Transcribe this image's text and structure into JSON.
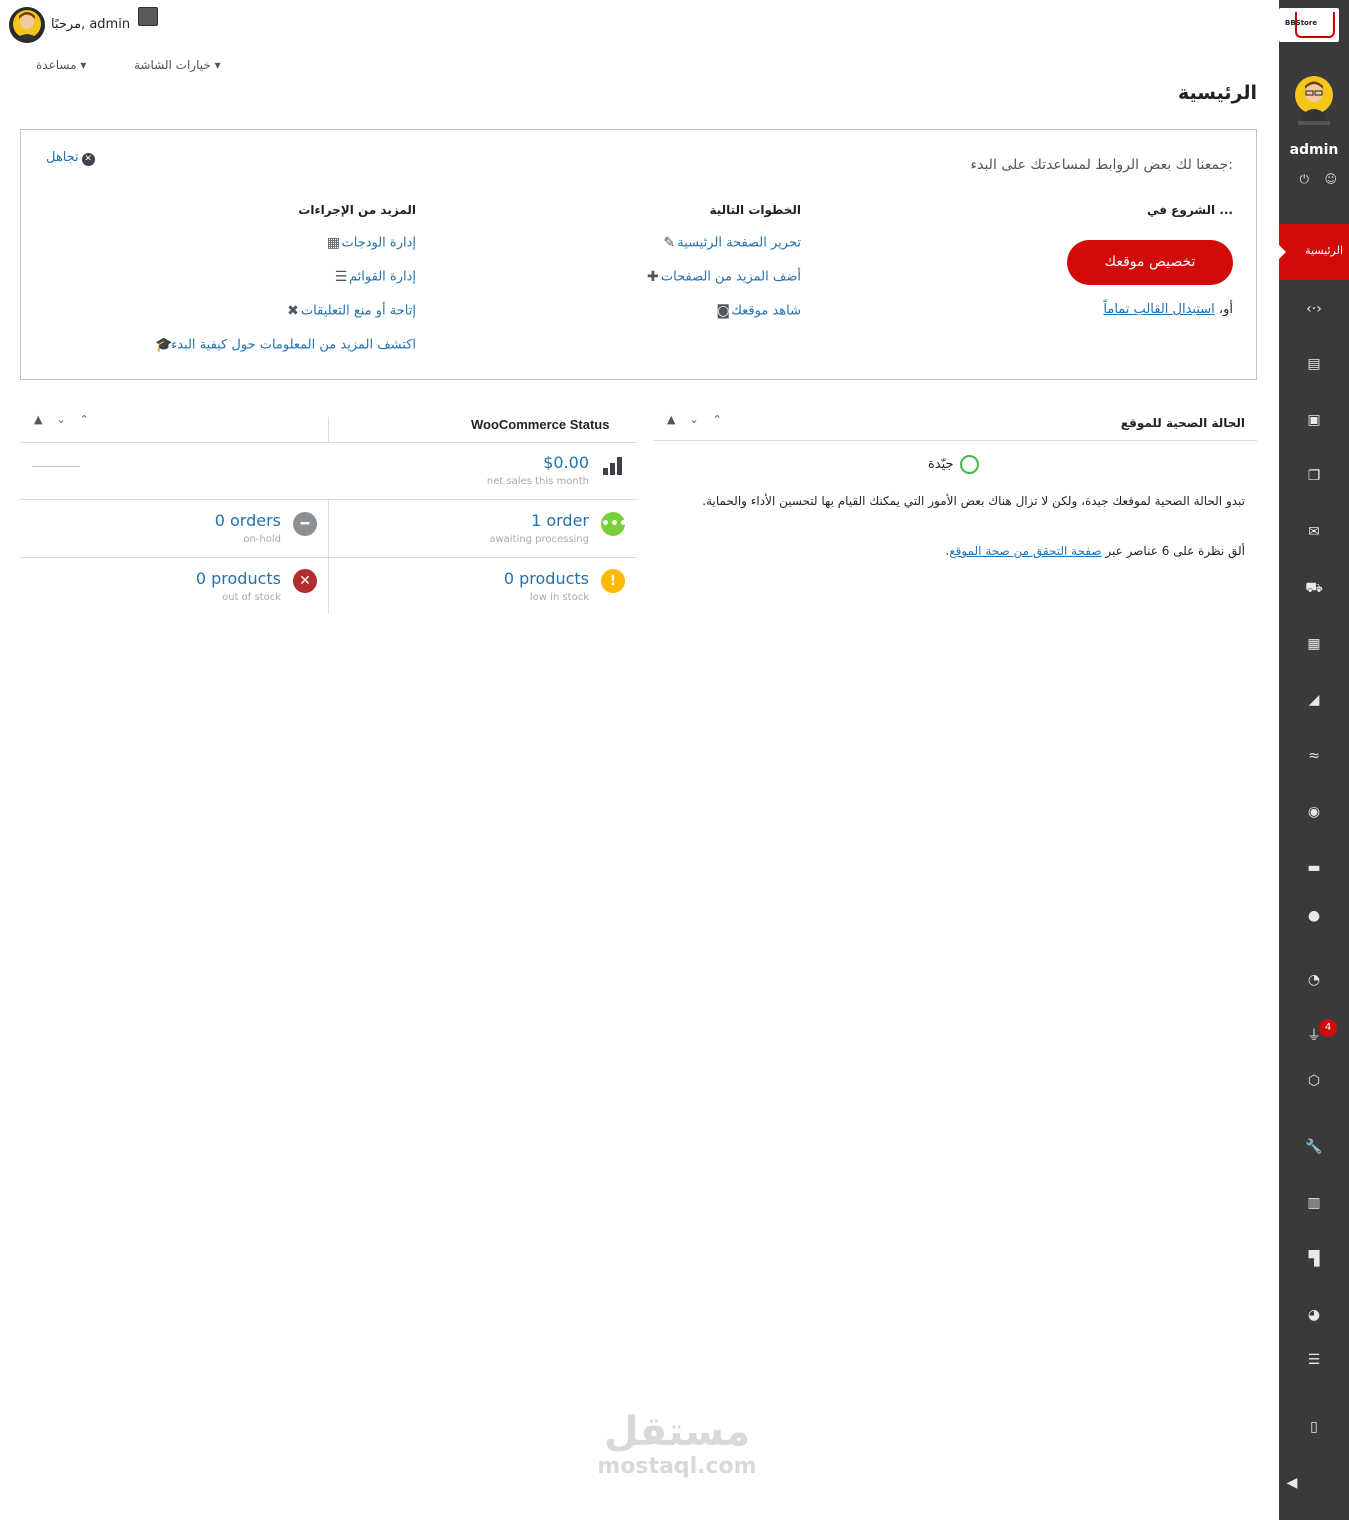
{
  "topbar": {
    "greeting": "مرحبًا, admin",
    "help": "مساعدة ▾",
    "screen_options": "خيارات الشاشة ▾"
  },
  "sidebar": {
    "logo_text": "BBStore",
    "username": "admin",
    "active_item": "الرئيسية",
    "plugins_badge": "4"
  },
  "page": {
    "title": "الرئيسية"
  },
  "welcome": {
    "dismiss": "تجاهل",
    "subtitle": "جمعنا لك بعض الروابط لمساعدتك على البدء:",
    "col1_title": "الشروع في ...",
    "cta": "تخصيص موقعك",
    "alt_prefix": "أو،",
    "alt_link": "استبدال القالب تماماً",
    "col2_title": "الخطوات التالية",
    "next_steps": [
      "تحرير الصفحة الرئيسية",
      "أضف المزيد من الصفحات",
      "شاهد موقعك"
    ],
    "col3_title": "المزيد من الإجراءات",
    "more_actions": [
      "إدارة الودجات",
      "إدارة القوائم",
      "إتاحة أو منع التعليقات",
      "اكتشف المزيد من المعلومات حول كيفية البدء"
    ]
  },
  "site_health": {
    "title": "الحالة الصحية للموقع",
    "status": "جيّدة",
    "description": "تبدو الحالة الصحية لموقعك جيدة، ولكن لا تزال هناك بعض الأمور التي يمكنك القيام بها لتحسين الأداء والحماية.",
    "link_prefix": "ألق نظرة على 6 عناصر عبر",
    "link_text": "صفحة التحقق من صحة الموقع",
    "link_suffix": "."
  },
  "woocommerce": {
    "title": "WooCommerce Status",
    "net_sales_value": "$0.00",
    "net_sales_label": "net sales this month",
    "awaiting_value": "1 order",
    "awaiting_label": "awaiting processing",
    "onhold_value": "0 orders",
    "onhold_label": "on-hold",
    "low_stock_value": "0 products",
    "low_stock_label": "low in stock",
    "out_stock_value": "0 products",
    "out_stock_label": "out of stock"
  },
  "watermark": {
    "arabic": "مستقل",
    "latin": "mostaql.com"
  },
  "colors": {
    "accent": "#d10a0a",
    "sidebar_bg": "#3a3a3a",
    "link": "#2271b1",
    "good": "#46b450",
    "warning": "#ffb900",
    "error": "#b32d2e",
    "neutral": "#8c8f94"
  }
}
